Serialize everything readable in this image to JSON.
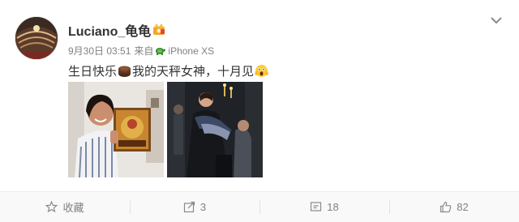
{
  "user": {
    "name": "Luciano_龟龟",
    "avatar_icon": "avatar-theater-photo",
    "badge_icon": "vip-crown-badge-icon"
  },
  "meta": {
    "date": "9月30日 03:51",
    "from_label": "来自",
    "device_icon": "turtle-icon",
    "device": "iPhone XS"
  },
  "post": {
    "text_1": "生日快乐",
    "text_2": "我的天秤女神，十月见",
    "emoji_1": "cake-emoji",
    "emoji_2": "scream-emoji"
  },
  "photos": [
    {
      "name": "photo-woman-holding-record"
    },
    {
      "name": "photo-opera-stage-scene"
    }
  ],
  "actions": {
    "favorite_label": "收藏",
    "repost_count": "3",
    "comment_count": "18",
    "like_count": "82"
  },
  "colors": {
    "text": "#333333",
    "meta": "#808080",
    "badge": "#f5a623"
  }
}
